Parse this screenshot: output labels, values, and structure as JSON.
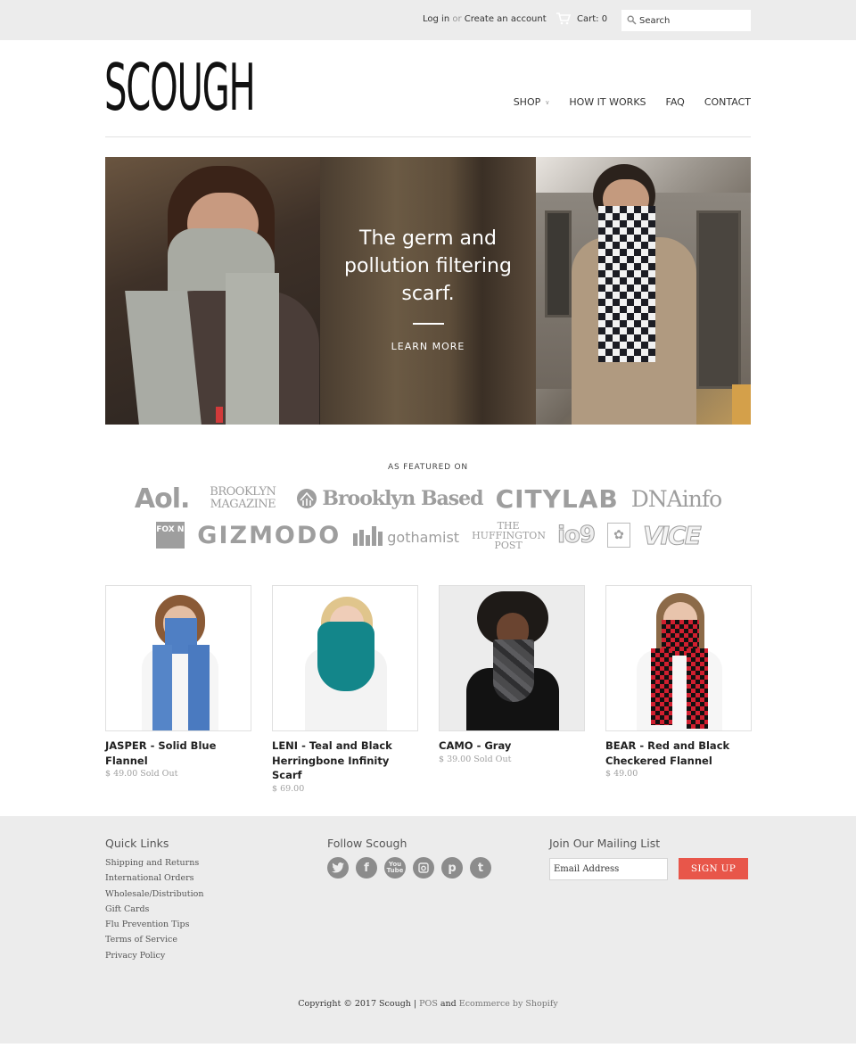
{
  "topbar": {
    "login_label": "Log in",
    "or_label": "or",
    "create_account_label": "Create an account",
    "cart_icon": "shopping-cart-icon",
    "cart_label": "Cart: 0",
    "search_icon": "search-icon",
    "search_placeholder": "Search"
  },
  "header": {
    "logo_text": "SCOUGH",
    "nav": [
      {
        "label": "SHOP",
        "has_dropdown": true
      },
      {
        "label": "HOW IT WORKS"
      },
      {
        "label": "FAQ"
      },
      {
        "label": "CONTACT"
      }
    ],
    "dropdown_icon": "chevron-down-icon"
  },
  "hero": {
    "headline": "The germ and pollution filtering scarf.",
    "cta_label": "LEARN MORE"
  },
  "featured": {
    "title": "AS FEATURED ON",
    "row1": [
      "Aol.",
      "BROOKLYN MAGAZINE",
      "Brooklyn Based",
      "CITYLAB",
      "DNAinfo"
    ],
    "row2": [
      "FOX NEWS",
      "GIZMODO",
      "gothamist",
      "THE HUFFINGTON POST",
      "io9",
      "emblem",
      "VICE"
    ]
  },
  "products": [
    {
      "title": "JASPER - Solid Blue Flannel",
      "price": "$ 49.00",
      "status": "Sold Out",
      "scarf_color": "#4f7fc4"
    },
    {
      "title": "LENI - Teal and Black Herringbone Infinity Scarf",
      "price": "$ 69.00",
      "status": "",
      "scarf_color": "#13868a"
    },
    {
      "title": "CAMO - Gray",
      "price": "$ 39.00",
      "status": "Sold Out",
      "scarf_color": "#4a4a4c"
    },
    {
      "title": "BEAR - Red and Black Checkered Flannel",
      "price": "$ 49.00",
      "status": "",
      "scarf_color": "#c8202e"
    }
  ],
  "footer": {
    "quick_links_title": "Quick Links",
    "quick_links": [
      "Shipping and Returns",
      "International Orders",
      "Wholesale/Distribution",
      "Gift Cards",
      "Flu Prevention Tips",
      "Terms of Service",
      "Privacy Policy"
    ],
    "follow_title": "Follow Scough",
    "social": [
      {
        "name": "twitter",
        "glyph": "🐦"
      },
      {
        "name": "facebook",
        "glyph": "f"
      },
      {
        "name": "youtube",
        "glyph": "▶"
      },
      {
        "name": "instagram",
        "glyph": "◙"
      },
      {
        "name": "pinterest",
        "glyph": "p"
      },
      {
        "name": "tumblr",
        "glyph": "t"
      }
    ],
    "mailing_title": "Join Our Mailing List",
    "email_placeholder": "Email Address",
    "signup_label": "SIGN UP",
    "copyright": "Copyright © 2017 Scough |",
    "pos_label": "POS",
    "and_label": "and",
    "ecommerce_label": "Ecommerce by Shopify"
  },
  "colors": {
    "accent": "#e8564a",
    "topbar_bg": "#ececec",
    "footer_bg": "#ececec"
  }
}
